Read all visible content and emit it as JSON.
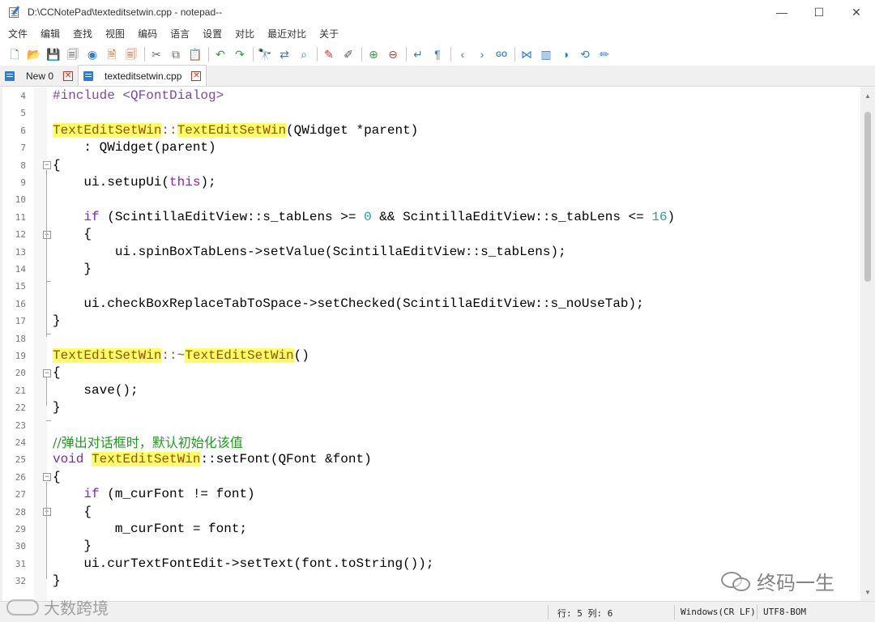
{
  "window": {
    "title": "D:\\CCNotePad\\texteditsetwin.cpp - notepad--",
    "controls": {
      "minimize": "—",
      "maximize": "☐",
      "close": "✕"
    }
  },
  "menu": [
    "文件",
    "编辑",
    "查找",
    "视图",
    "编码",
    "语言",
    "设置",
    "对比",
    "最近对比",
    "关于"
  ],
  "toolbar": [
    {
      "name": "new-file-icon",
      "glyph": "🗋",
      "color": "#2e9e3e"
    },
    {
      "name": "open-file-icon",
      "glyph": "📂",
      "color": "#e0a020"
    },
    {
      "name": "save-icon",
      "glyph": "💾",
      "color": "#555"
    },
    {
      "name": "save-all-icon",
      "glyph": "🗐",
      "color": "#555"
    },
    {
      "name": "reload-icon",
      "glyph": "◉",
      "color": "#2c7fd0"
    },
    {
      "name": "close-file-icon",
      "glyph": "🗎",
      "color": "#d05a1a"
    },
    {
      "name": "close-all-icon",
      "glyph": "🗐",
      "color": "#d05a1a"
    },
    {
      "sep": true
    },
    {
      "name": "cut-icon",
      "glyph": "✂",
      "color": "#666"
    },
    {
      "name": "copy-icon",
      "glyph": "⧉",
      "color": "#666"
    },
    {
      "name": "paste-icon",
      "glyph": "📋",
      "color": "#b07a2a"
    },
    {
      "sep": true
    },
    {
      "name": "undo-icon",
      "glyph": "↶",
      "color": "#2e9e3e"
    },
    {
      "name": "redo-icon",
      "glyph": "↷",
      "color": "#2e9e3e"
    },
    {
      "sep": true
    },
    {
      "name": "find-icon",
      "glyph": "🔭",
      "color": "#333"
    },
    {
      "name": "replace-icon",
      "glyph": "⇄",
      "color": "#2c7fd0"
    },
    {
      "name": "find-in-files-icon",
      "glyph": "⌕",
      "color": "#2c7fd0"
    },
    {
      "sep": true
    },
    {
      "name": "mark-icon",
      "glyph": "✎",
      "color": "#d03030"
    },
    {
      "name": "clear-mark-icon",
      "glyph": "✐",
      "color": "#555"
    },
    {
      "sep": true
    },
    {
      "name": "zoom-in-icon",
      "glyph": "⊕",
      "color": "#2e9e3e"
    },
    {
      "name": "zoom-out-icon",
      "glyph": "⊖",
      "color": "#d03030"
    },
    {
      "sep": true
    },
    {
      "name": "word-wrap-icon",
      "glyph": "↵",
      "color": "#2c7fd0"
    },
    {
      "name": "show-symbols-icon",
      "glyph": "¶",
      "color": "#2c7fd0"
    },
    {
      "sep": true
    },
    {
      "name": "prev-icon",
      "glyph": "‹",
      "color": "#2c7fd0"
    },
    {
      "name": "next-icon",
      "glyph": "›",
      "color": "#2c7fd0"
    },
    {
      "name": "goto-icon",
      "glyph": "GO",
      "color": "#2c7fd0"
    },
    {
      "sep": true
    },
    {
      "name": "compare-icon",
      "glyph": "⋈",
      "color": "#2c7fd0"
    },
    {
      "name": "dir-compare-icon",
      "glyph": "▥",
      "color": "#2c7fd0"
    },
    {
      "name": "theme-icon",
      "glyph": "◑",
      "color": "#2c7fd0"
    },
    {
      "name": "sync-scroll-icon",
      "glyph": "⟲",
      "color": "#2c7fd0"
    },
    {
      "name": "edit-icon",
      "glyph": "✏",
      "color": "#2c7fd0"
    }
  ],
  "tabs": [
    {
      "label": "New 0",
      "close": "✕",
      "active": false
    },
    {
      "label": "texteditsetwin.cpp",
      "close": "✕",
      "active": true
    }
  ],
  "code_lines": [
    {
      "n": "4",
      "fold": "",
      "parts": [
        {
          "t": "#include <QFontDialog>",
          "c": "pp"
        }
      ]
    },
    {
      "n": "5",
      "fold": "",
      "parts": []
    },
    {
      "n": "6",
      "fold": "",
      "parts": [
        {
          "t": "TextEditSetWin",
          "c": "hl"
        },
        {
          "t": "::",
          "c": "hlcolon"
        },
        {
          "t": "TextEditSetWin",
          "c": "hl"
        },
        {
          "t": "(QWidget *parent)",
          "c": ""
        }
      ]
    },
    {
      "n": "7",
      "fold": "",
      "parts": [
        {
          "t": "    : QWidget(parent)",
          "c": ""
        }
      ]
    },
    {
      "n": "8",
      "fold": "box",
      "parts": [
        {
          "t": "{",
          "c": ""
        }
      ]
    },
    {
      "n": "9",
      "fold": "",
      "parts": [
        {
          "t": "    ui.setupUi(",
          "c": ""
        },
        {
          "t": "this",
          "c": "kw"
        },
        {
          "t": ");",
          "c": ""
        }
      ]
    },
    {
      "n": "10",
      "fold": "",
      "parts": []
    },
    {
      "n": "11",
      "fold": "",
      "parts": [
        {
          "t": "    ",
          "c": ""
        },
        {
          "t": "if",
          "c": "kw"
        },
        {
          "t": " (ScintillaEditView::s_tabLens >= ",
          "c": ""
        },
        {
          "t": "0",
          "c": "num"
        },
        {
          "t": " && ScintillaEditView::s_tabLens <= ",
          "c": ""
        },
        {
          "t": "16",
          "c": "num"
        },
        {
          "t": ")",
          "c": ""
        }
      ]
    },
    {
      "n": "12",
      "fold": "box",
      "parts": [
        {
          "t": "    {",
          "c": ""
        }
      ]
    },
    {
      "n": "13",
      "fold": "",
      "parts": [
        {
          "t": "        ui.spinBoxTabLens->setValue(ScintillaEditView::s_tabLens);",
          "c": ""
        }
      ]
    },
    {
      "n": "14",
      "fold": "",
      "parts": [
        {
          "t": "    }",
          "c": ""
        }
      ]
    },
    {
      "n": "15",
      "fold": "end",
      "parts": []
    },
    {
      "n": "16",
      "fold": "",
      "parts": [
        {
          "t": "    ui.checkBoxReplaceTabToSpace->setChecked(ScintillaEditView::s_noUseTab);",
          "c": ""
        }
      ]
    },
    {
      "n": "17",
      "fold": "",
      "parts": [
        {
          "t": "}",
          "c": ""
        }
      ]
    },
    {
      "n": "18",
      "fold": "end",
      "parts": []
    },
    {
      "n": "19",
      "fold": "",
      "parts": [
        {
          "t": "TextEditSetWin",
          "c": "hl"
        },
        {
          "t": "::~",
          "c": "hlcolon"
        },
        {
          "t": "TextEditSetWin",
          "c": "hl"
        },
        {
          "t": "()",
          "c": ""
        }
      ]
    },
    {
      "n": "20",
      "fold": "box",
      "parts": [
        {
          "t": "{",
          "c": ""
        }
      ]
    },
    {
      "n": "21",
      "fold": "",
      "parts": [
        {
          "t": "    save();",
          "c": ""
        }
      ]
    },
    {
      "n": "22",
      "fold": "",
      "parts": [
        {
          "t": "}",
          "c": ""
        }
      ]
    },
    {
      "n": "23",
      "fold": "end",
      "parts": []
    },
    {
      "n": "24",
      "fold": "",
      "parts": [
        {
          "t": "//弹出对话框时，默认初始化该值",
          "c": "cm"
        }
      ]
    },
    {
      "n": "25",
      "fold": "",
      "parts": [
        {
          "t": "void",
          "c": "kw"
        },
        {
          "t": " ",
          "c": ""
        },
        {
          "t": "TextEditSetWin",
          "c": "hl"
        },
        {
          "t": "::setFont(QFont &font)",
          "c": ""
        }
      ]
    },
    {
      "n": "26",
      "fold": "box",
      "parts": [
        {
          "t": "{",
          "c": ""
        }
      ]
    },
    {
      "n": "27",
      "fold": "",
      "parts": [
        {
          "t": "    ",
          "c": ""
        },
        {
          "t": "if",
          "c": "kw"
        },
        {
          "t": " (m_curFont != font)",
          "c": ""
        }
      ]
    },
    {
      "n": "28",
      "fold": "box",
      "parts": [
        {
          "t": "    {",
          "c": ""
        }
      ]
    },
    {
      "n": "29",
      "fold": "",
      "parts": [
        {
          "t": "        m_curFont = font;",
          "c": ""
        }
      ]
    },
    {
      "n": "30",
      "fold": "",
      "parts": [
        {
          "t": "    }",
          "c": ""
        }
      ]
    },
    {
      "n": "31",
      "fold": "",
      "parts": [
        {
          "t": "    ui.curTextFontEdit->setText(font.toString());",
          "c": ""
        }
      ]
    },
    {
      "n": "32",
      "fold": "",
      "parts": [
        {
          "t": "}",
          "c": ""
        }
      ]
    }
  ],
  "statusbar": {
    "position": "行: 5 列: 6",
    "line_ending": "Windows(CR LF)",
    "encoding": "UTF8-BOM"
  },
  "watermarks": {
    "right": "终码一生",
    "left": "大数跨境"
  }
}
